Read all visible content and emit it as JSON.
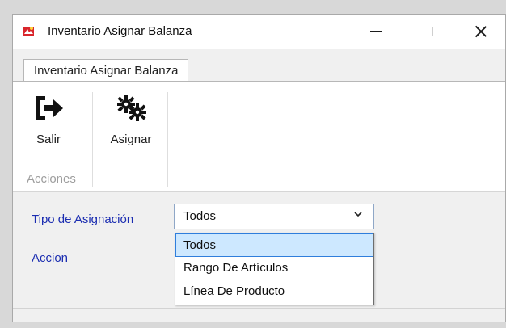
{
  "window": {
    "title": "Inventario Asignar Balanza",
    "app_icon": "app-logo-icon",
    "controls": {
      "minimize": "minimize-icon",
      "maximize": "maximize-icon",
      "close": "close-icon"
    }
  },
  "ribbon": {
    "tab_label": "Inventario Asignar Balanza",
    "group_label": "Acciones",
    "buttons": [
      {
        "label": "Salir",
        "icon": "exit-icon"
      },
      {
        "label": "Asignar",
        "icon": "gears-icon"
      }
    ]
  },
  "form": {
    "tipo_label": "Tipo de Asignación",
    "accion_label": "Accion",
    "selected_value": "Todos",
    "dropdown_icon": "chevron-down-icon",
    "options": [
      "Todos",
      "Rango De Artículos",
      "Línea De Producto"
    ]
  },
  "colors": {
    "label_blue": "#1b2db1",
    "selection_blue": "#cde8ff",
    "selection_border": "#2f7edc",
    "window_bg": "#f0f0f0"
  }
}
